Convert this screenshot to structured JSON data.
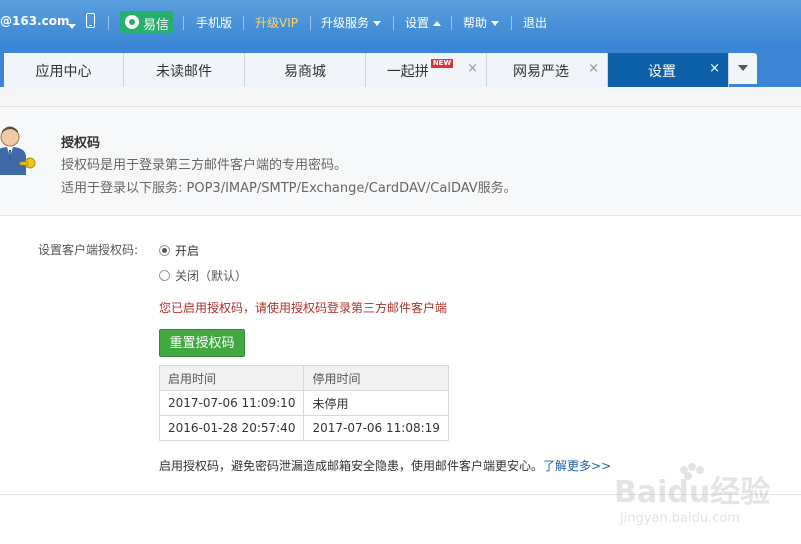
{
  "topbar": {
    "email": "@163.com",
    "yixin": "易信",
    "mobile": "手机版",
    "vip": "升级VIP",
    "upgrade_service": "升级服务",
    "settings": "设置",
    "help": "帮助",
    "logout": "退出"
  },
  "tabs": [
    {
      "label": "应用中心"
    },
    {
      "label": "未读邮件"
    },
    {
      "label": "易商城"
    },
    {
      "label": "一起拼",
      "badge": "NEW"
    },
    {
      "label": "网易严选"
    },
    {
      "label": "设置",
      "active": true
    }
  ],
  "close_glyph": "×",
  "auth": {
    "title": "授权码",
    "desc1": "授权码是用于登录第三方邮件客户端的专用密码。",
    "desc2": "适用于登录以下服务: POP3/IMAP/SMTP/Exchange/CardDAV/CalDAV服务。"
  },
  "setting": {
    "label": "设置客户端授权码:",
    "option_on": "开启",
    "option_off": "关闭（默认）",
    "selected": "开启",
    "enabled_message": "您已启用授权码，请使用授权码登录第三方邮件客户端",
    "reset_button": "重置授权码"
  },
  "table": {
    "headers": [
      "启用时间",
      "停用时间"
    ],
    "rows": [
      [
        "2017-07-06 11:09:10",
        "未停用"
      ],
      [
        "2016-01-28 20:57:40",
        "2017-07-06 11:08:19"
      ]
    ]
  },
  "footer": {
    "note": "启用授权码，避免密码泄漏造成邮箱安全隐患，使用邮件客户端更安心。",
    "learn_more": "了解更多>>"
  },
  "watermark": {
    "brand": "Baidu经验",
    "url": "jingyan.baidu.com"
  },
  "colors": {
    "topbar_blue": "#3b86d4",
    "active_tab": "#0e61a8",
    "button_green": "#42a842",
    "message_red": "#b3302b",
    "link_blue": "#1f5fa8"
  }
}
